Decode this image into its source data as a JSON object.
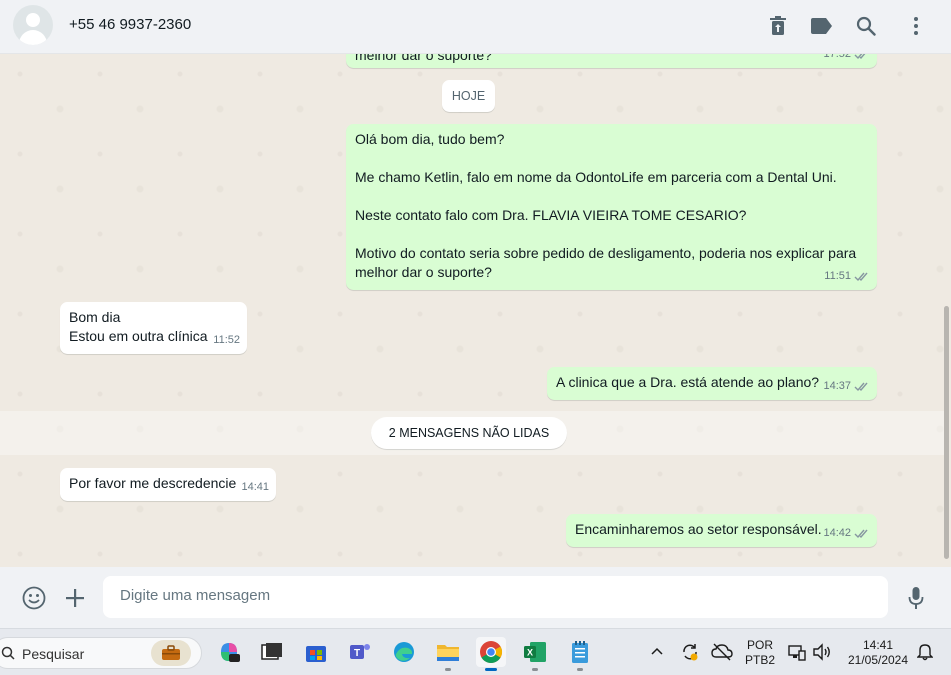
{
  "header": {
    "contact": "+55 46 9937-2360"
  },
  "chat": {
    "prev_partial_text": "melhor dar o suporte?",
    "prev_partial_time": "17:52",
    "date_divider": "HOJE",
    "messages": [
      {
        "dir": "out",
        "lines": [
          "Olá bom dia, tudo bem?",
          "",
          "Me chamo Ketlin, falo em nome da OdontoLife em parceria com a Dental Uni.",
          "",
          "Neste contato falo com Dra. FLAVIA VIEIRA TOME CESARIO?",
          "",
          "Motivo do contato seria sobre pedido de desligamento, poderia nos explicar para",
          "melhor dar o suporte?"
        ],
        "time": "11:51"
      },
      {
        "dir": "in",
        "lines": [
          "Bom dia",
          "Estou em outra clínica"
        ],
        "time": "11:52"
      },
      {
        "dir": "out",
        "lines": [
          "A clinica que a Dra. está atende ao plano?"
        ],
        "time": "14:37"
      },
      {
        "dir": "in",
        "lines": [
          "Por favor me descredencie"
        ],
        "time": "14:41"
      },
      {
        "dir": "out",
        "lines": [
          "Encaminharemos ao setor responsável."
        ],
        "time": "14:42"
      }
    ],
    "unread_divider": "2 MENSAGENS NÃO LIDAS"
  },
  "composer": {
    "placeholder": "Digite uma mensagem"
  },
  "taskbar": {
    "search_label": "Pesquisar",
    "lang_top": "POR",
    "lang_bottom": "PTB2",
    "time": "14:41",
    "date": "21/05/2024",
    "apps": [
      "briefcase-icon",
      "copilot-icon",
      "task-view-icon",
      "microsoft-store-icon",
      "teams-icon",
      "edge-icon",
      "file-explorer-icon",
      "chrome-icon",
      "excel-icon",
      "notepad-icon"
    ]
  },
  "colors": {
    "outgoing": "#d9fdd3",
    "incoming": "#ffffff",
    "background": "#efeae2",
    "tick": "#8696a0"
  }
}
